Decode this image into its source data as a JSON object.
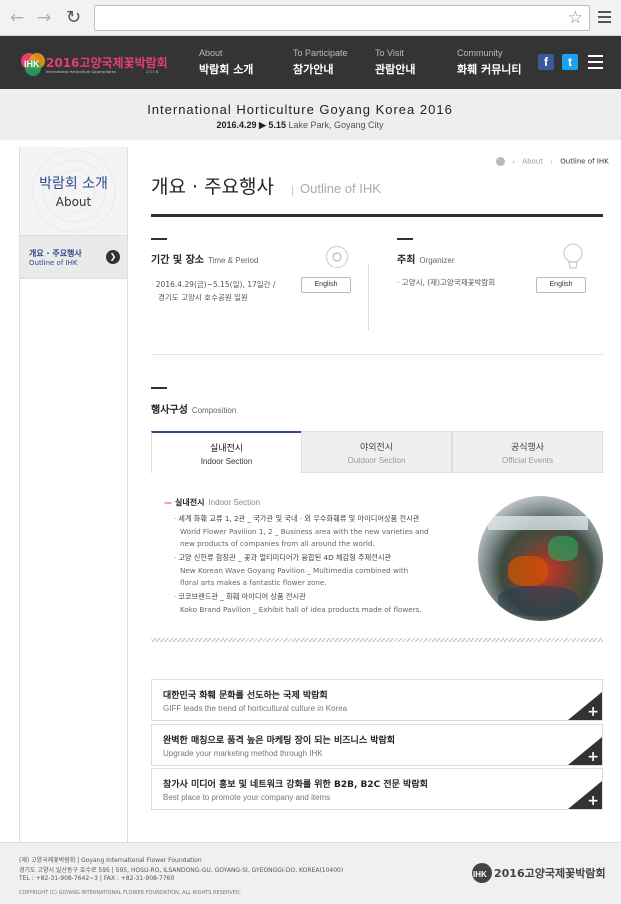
{
  "browser": {
    "back_icon": "arrow-left-icon",
    "forward_icon": "arrow-right-icon",
    "reload_icon": "reload-icon",
    "url": "",
    "star_icon": "star-icon",
    "menu_icon": "menu-icon"
  },
  "header": {
    "logo_text": "2016고양국제꽃박람회",
    "logo_sub": "International Horticulture Goyang Korea",
    "logo_year_small": "2 0 1 6",
    "nav": [
      {
        "en": "About",
        "ko": "박람회 소개"
      },
      {
        "en": "To Participate",
        "ko": "참가안내"
      },
      {
        "en": "To Visit",
        "ko": "관람안내"
      },
      {
        "en": "Community",
        "ko": "화훼 커뮤니티"
      }
    ],
    "facebook": "f",
    "twitter": "t",
    "colors": {
      "bar": "#343434",
      "logo": "#e73f6f",
      "facebook": "#3b5998",
      "twitter": "#1da1f2"
    }
  },
  "banner": {
    "title": "International  Horticulture  Goyang  Korea 2016",
    "date": "2016.4.29 ▶ 5.15",
    "place": "Lake Park, Goyang City"
  },
  "sidebar": {
    "title_ko": "박람회 소개",
    "title_en": "About",
    "item_ko": "개요 · 주요행사",
    "item_en": "Outline of IHK"
  },
  "breadcrumb": {
    "items": [
      "About",
      "Outline of IHK"
    ],
    "sep": "›"
  },
  "page": {
    "title": "개요 · 주요행사",
    "subtitle": "Outline of IHK"
  },
  "period": {
    "ko": "기간 및 장소",
    "en": "Time & Period",
    "text1": "2016.4.29(금)~5.15(일), 17일간 /",
    "text2": "경기도 고양시 호수공원 일원",
    "button": "English"
  },
  "organizer": {
    "ko": "주최",
    "en": "Organizer",
    "text": "고양시, (재)고양국제꽃박람회",
    "button": "English"
  },
  "composition": {
    "ko": "행사구성",
    "en": "Composition"
  },
  "tabs": [
    {
      "ko": "실내전시",
      "en": "Indoor Section"
    },
    {
      "ko": "야외전시",
      "en": "Outdoor Section"
    },
    {
      "ko": "공식행사",
      "en": "Official Events"
    }
  ],
  "indoor": {
    "head_ko": "실내전시",
    "head_en": "Indoor Section",
    "items": [
      {
        "ko": "세계 화훼 교류 1, 2관 _ 국가관 및 국내 · 외 우수화훼류 및 아이디어상품 전시관",
        "en1": "World Flower Pavilion 1, 2 _ Business area with the new varieties and",
        "en2": "new products of companies from all around the world."
      },
      {
        "ko": "고양 신한류 함창관 _ 꽃과 멀티미디어가 융합된 4D 체감형 주제전시관",
        "en1": "New Korean Wave Goyang Pavilion _ Multimedia combined with",
        "en2": "floral arts makes a fantastic flower zone."
      },
      {
        "ko": "코코브랜드관 _ 화훼 아이디어 상품 전시관",
        "en1": "Koko Brand Pavilion _ Exhibit hall of idea products made of flowers.",
        "en2": ""
      }
    ]
  },
  "features": [
    {
      "ko": "대한민국 화훼 문화를 선도하는 국제 박람회",
      "en": "GIFF leads the trend of horticultural culture in Korea"
    },
    {
      "ko": "완벽한 매칭으로 품격 높은 마케팅 장이 되는 비즈니스 박람회",
      "en": "Upgrade your marketing method through IHK"
    },
    {
      "ko": "참가사 미디어 홍보 및 네트워크 강화를 위한 B2B, B2C 전문 박람회",
      "en": "Best place to promote your company and items"
    }
  ],
  "footer": {
    "line1": "(재) 고양국제꽃박람회   |   Goyang International Flower Foundation",
    "line2": "경기도 고양시 일산동구 호수로 595   |   595, HOSU-RO, ILSANDONG-GU, GOYANG-SI, GYEONGGI-DO, KOREA(10400)",
    "line3": "TEL : +82-31-908-7642~3   |   FAX : +82-31-908-7760",
    "line4": "COPYRIGHT (C) GOYANG INTERNATIONAL FLOWER FOUNDATION, ALL RIGHTS RESERVED.",
    "logo_text": "2016고양국제꽃박람회"
  }
}
